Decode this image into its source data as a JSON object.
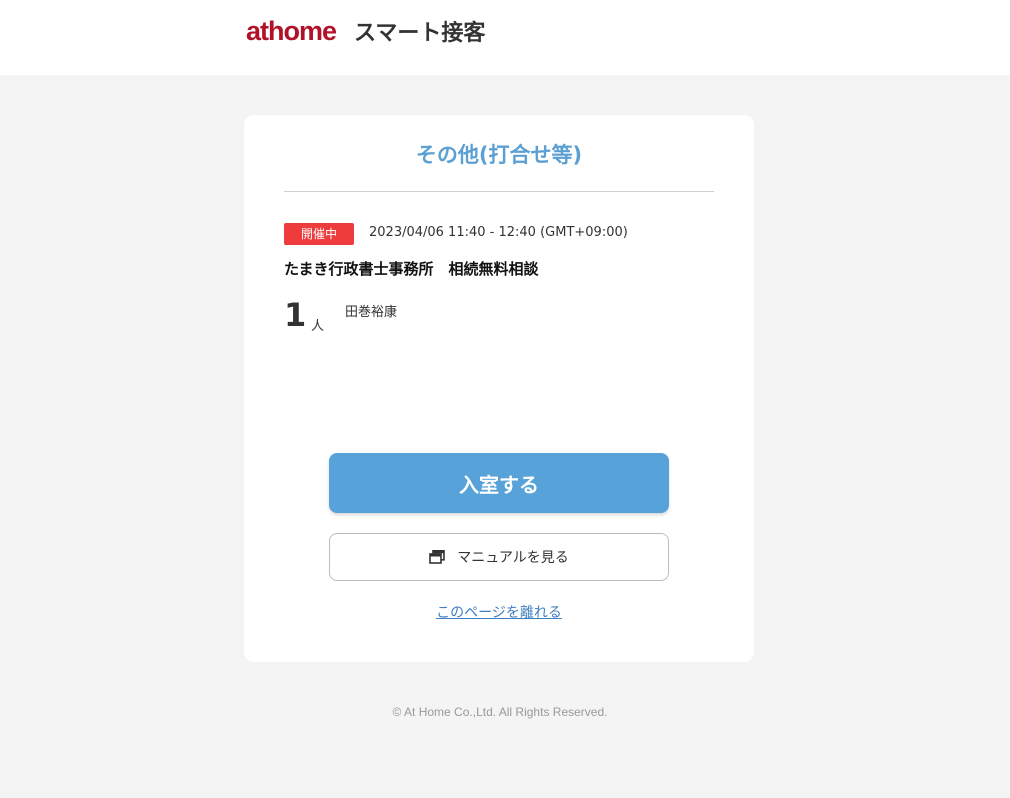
{
  "header": {
    "brand": "athome",
    "service_name": "スマート接客",
    "brand_color": "#b1122a"
  },
  "card": {
    "title": "その他(打合せ等)",
    "status_badge": "開催中",
    "status_color": "#ee3b3b",
    "datetime": "2023/04/06 11:40 - 12:40 (GMT+09:00)",
    "event_name": "たまき行政書士事務所　相続無料相談",
    "participant_count": "1",
    "participant_unit": "人",
    "participant_name": "田巻裕康",
    "enter_button_label": "入室する",
    "manual_button_label": "マニュアルを見る",
    "manual_icon": "windows-icon",
    "leave_link_label": "このページを離れる",
    "accent_color": "#57a2d8"
  },
  "footer": {
    "copyright": "© At Home Co.,Ltd. All Rights Reserved."
  }
}
